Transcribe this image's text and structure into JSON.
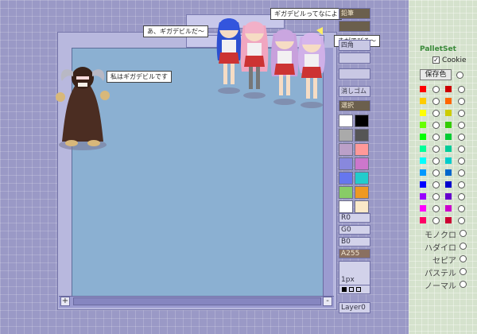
{
  "bubbles": {
    "demon": "私はギガデビルです",
    "konata": "あ、ギガデビルだ〜",
    "top": "ギガデビルってなによ",
    "right": "きがでびる〜"
  },
  "tools": {
    "labels": [
      "鉛筆",
      "",
      "四角",
      "",
      "",
      "消しゴム",
      "選択",
      ""
    ],
    "r": "R0",
    "g": "G0",
    "b": "B0",
    "a": "A255",
    "brush": "1px",
    "layer": "Layer0"
  },
  "swatches": [
    "#ffffff",
    "#000000",
    "#aaaaaa",
    "#555555",
    "#bba0c8",
    "#ff9999",
    "#8888dd",
    "#cc77cc",
    "#6677ee",
    "#22cccc",
    "#88cc66",
    "#ee9922",
    "#ffffff",
    "#fbe9c8"
  ],
  "palette": {
    "title": "PalletSet",
    "cookie_label": "Cookie",
    "save_label": "保存色",
    "colors": [
      "#ff0000",
      "#ffcc00",
      "#ffff00",
      "#66ff00",
      "#00ff00",
      "#00ff99",
      "#00ffff",
      "#0099ff",
      "#0000ff",
      "#9900ff",
      "#ff00ff",
      "#ff0066"
    ],
    "colors2": [
      "#cc0000",
      "#ff6600",
      "#cccc00",
      "#33cc00",
      "#00cc33",
      "#00cc99",
      "#00cccc",
      "#0066cc",
      "#0000cc",
      "#6600cc",
      "#cc00cc",
      "#cc0033"
    ],
    "presets": [
      "モノクロ",
      "ハダイロ",
      "セピア",
      "パステル",
      "ノーマル"
    ]
  },
  "scroll": {
    "plus": "+",
    "minus": "-"
  }
}
